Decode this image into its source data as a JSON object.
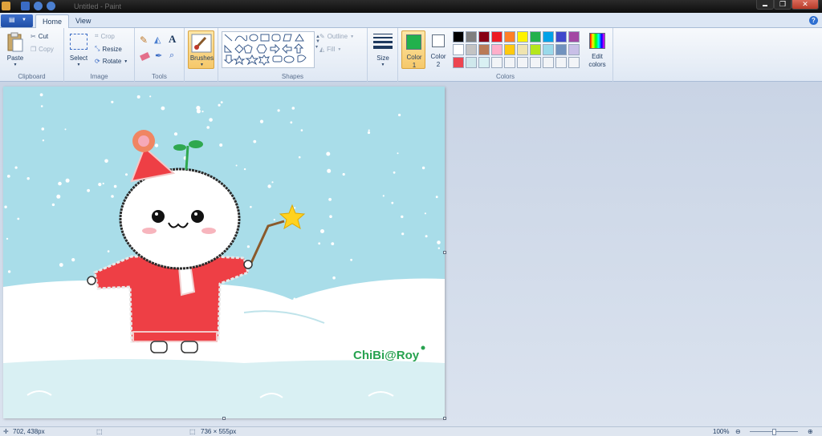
{
  "window": {
    "title": "Untitled - Paint",
    "minimize": "▬",
    "restore": "❐",
    "close": "✕"
  },
  "tabs": [
    {
      "label": "Home",
      "active": true
    },
    {
      "label": "View",
      "active": false
    }
  ],
  "help_label": "?",
  "ribbon": {
    "clipboard": {
      "label": "Clipboard",
      "paste": "Paste",
      "cut": "Cut",
      "copy": "Copy"
    },
    "image": {
      "label": "Image",
      "select": "Select",
      "crop": "Crop",
      "resize": "Resize",
      "rotate": "Rotate"
    },
    "tools": {
      "label": "Tools"
    },
    "brushes": {
      "label": "Brushes"
    },
    "shapes": {
      "label": "Shapes",
      "outline": "Outline",
      "fill": "Fill"
    },
    "size": {
      "label": "Size"
    },
    "colors": {
      "label": "Colors",
      "color1_label": "Color",
      "color1_num": "1",
      "color1_value": "#22b14c",
      "color2_label": "Color",
      "color2_num": "2",
      "color2_value": "#ffffff",
      "edit_label_1": "Edit",
      "edit_label_2": "colors",
      "palette_row1": [
        "#000000",
        "#7f7f7f",
        "#880015",
        "#ed1c24",
        "#ff7f27",
        "#fff200",
        "#22b14c",
        "#00a2e8",
        "#3f48cc",
        "#a349a4"
      ],
      "palette_row2": [
        "#ffffff",
        "#c3c3c3",
        "#b97a57",
        "#ffaec9",
        "#ffc90e",
        "#efe4b0",
        "#b5e61d",
        "#99d9ea",
        "#7092be",
        "#c8bfe7"
      ],
      "palette_row3": [
        "#ed4550",
        "#cfe8ec",
        "#d9f0f3",
        "",
        "",
        "",
        "",
        "",
        "",
        ""
      ]
    }
  },
  "canvas": {
    "signature": "ChiBi@Roy",
    "sky_color": "#a9dde9",
    "snow_color": "#ffffff",
    "sweater_color": "#ee3f45",
    "hat_color": "#ee3f45",
    "star_color": "#ffd21f"
  },
  "status": {
    "cursor_pos": "702, 438px",
    "image_size": "736 × 555px",
    "zoom": "100%"
  }
}
